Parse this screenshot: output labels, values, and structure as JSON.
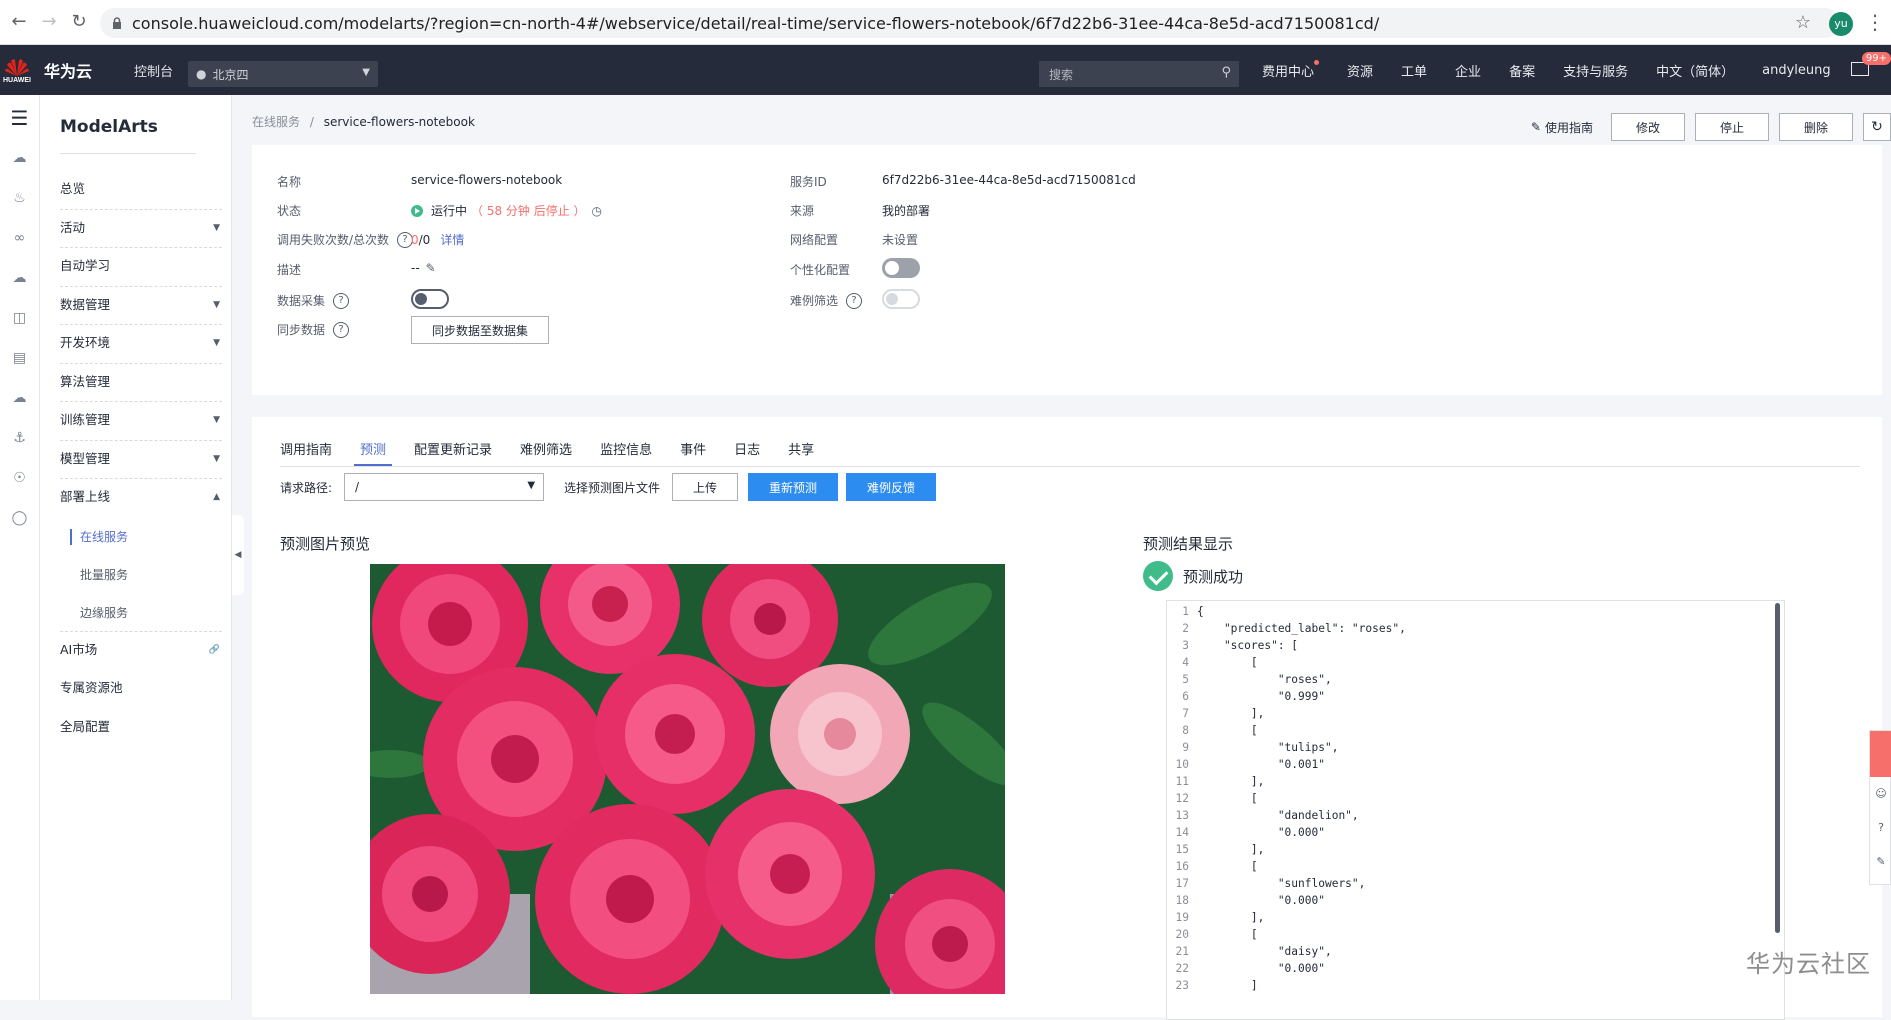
{
  "browser": {
    "url": "console.huaweicloud.com/modelarts/?region=cn-north-4#/webservice/detail/real-time/service-flowers-notebook/6f7d22b6-31ee-44ca-8e5d-acd7150081cd/",
    "avatar": "yu"
  },
  "topnav": {
    "logo_text": "HUAWEI",
    "brand": "华为云",
    "console": "控制台",
    "region": "北京四",
    "search_placeholder": "搜索",
    "items": [
      "费用中心",
      "资源",
      "工单",
      "企业",
      "备案",
      "支持与服务",
      "中文（简体）",
      "andyleung"
    ],
    "mail_badge": "99+"
  },
  "sidemenu": {
    "title": "ModelArts",
    "items": [
      "总览",
      "活动",
      "自动学习",
      "数据管理",
      "开发环境",
      "算法管理",
      "训练管理",
      "模型管理",
      "部署上线"
    ],
    "sub_items": [
      "在线服务",
      "批量服务",
      "边缘服务"
    ],
    "bottom_items": [
      "AI市场",
      "专属资源池",
      "全局配置"
    ]
  },
  "breadcrumb": {
    "parent": "在线服务",
    "sep": "/",
    "current": "service-flowers-notebook"
  },
  "actions": {
    "guide": "使用指南",
    "modify": "修改",
    "stop": "停止",
    "delete": "删除"
  },
  "info": {
    "name_label": "名称",
    "name_value": "service-flowers-notebook",
    "status_label": "状态",
    "status_value": "运行中",
    "status_note": "（ 58 分钟 后停止 ）",
    "calls_label": "调用失败次数/总次数",
    "calls_fail": "0",
    "calls_total": "/0",
    "calls_detail": "详情",
    "desc_label": "描述",
    "desc_value": "--",
    "collect_label": "数据采集",
    "sync_label": "同步数据",
    "sync_button": "同步数据至数据集",
    "service_id_label": "服务ID",
    "service_id_value": "6f7d22b6-31ee-44ca-8e5d-acd7150081cd",
    "source_label": "来源",
    "source_value": "我的部署",
    "network_label": "网络配置",
    "network_value": "未设置",
    "personal_label": "个性化配置",
    "hard_label": "难例筛选"
  },
  "tabs": [
    "调用指南",
    "预测",
    "配置更新记录",
    "难例筛选",
    "监控信息",
    "事件",
    "日志",
    "共享"
  ],
  "request": {
    "path_label": "请求路径:",
    "path_value": "/",
    "file_label": "选择预测图片文件",
    "upload": "上传",
    "repredict": "重新预测",
    "feedback": "难例反馈"
  },
  "preview_title": "预测图片预览",
  "result": {
    "title": "预测结果显示",
    "success": "预测成功",
    "lines": [
      "{",
      "    \"predicted_label\": \"roses\",",
      "    \"scores\": [",
      "        [",
      "            \"roses\",",
      "            \"0.999\"",
      "        ],",
      "        [",
      "            \"tulips\",",
      "            \"0.001\"",
      "        ],",
      "        [",
      "            \"dandelion\",",
      "            \"0.000\"",
      "        ],",
      "        [",
      "            \"sunflowers\",",
      "            \"0.000\"",
      "        ],",
      "        [",
      "            \"daisy\",",
      "            \"0.000\"",
      "        ]"
    ]
  },
  "watermark": "华为云社区",
  "colors": {
    "accent": "#526ecc",
    "primary_button": "#2d8cf0",
    "success": "#3fbc8a",
    "warning_text": "#f66f6a",
    "topnav": "#252b3a"
  }
}
